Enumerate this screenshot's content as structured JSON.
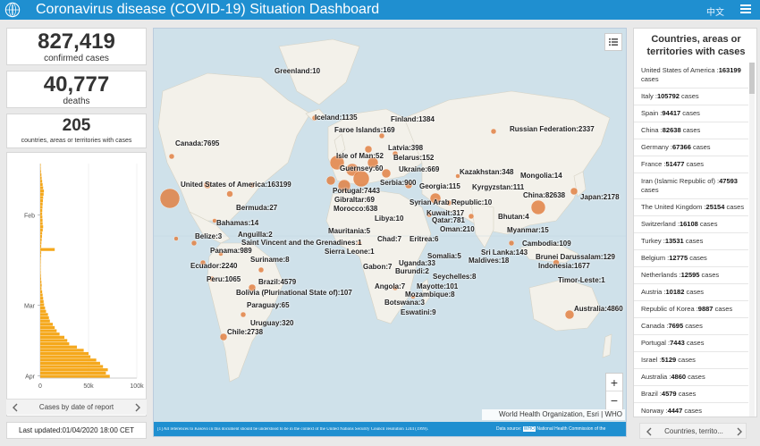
{
  "header": {
    "title": "Coronavirus disease (COVID-19) Situation Dashboard",
    "lang": "中文"
  },
  "stats": {
    "confirmed": {
      "value": "827,419",
      "label": "confirmed cases"
    },
    "deaths": {
      "value": "40,777",
      "label": "deaths"
    },
    "countries": {
      "value": "205",
      "label": "countries, areas or territories with cases"
    }
  },
  "epi_chart": {
    "footer_label": "Cases by date of report",
    "y_labels": [
      "Feb",
      "Mar",
      "Apr"
    ],
    "x_labels": [
      "0",
      "50k",
      "100k"
    ]
  },
  "chart_data": {
    "type": "bar",
    "orientation": "horizontal",
    "x_axis_ticks": [
      "0",
      "50k",
      "100k"
    ],
    "y_axis_ticks": [
      "Feb",
      "Mar",
      "Apr"
    ],
    "xlim": [
      0,
      100000
    ],
    "values": [
      200,
      500,
      800,
      1200,
      1500,
      2000,
      2500,
      3000,
      3800,
      3500,
      3000,
      2800,
      2500,
      2300,
      2100,
      2000,
      2200,
      2400,
      2500,
      3000,
      2600,
      2000,
      1800,
      1500,
      1200,
      1000,
      15000,
      1000,
      800,
      600,
      500,
      400,
      400,
      500,
      700,
      900,
      1200,
      1500,
      1300,
      2000,
      2500,
      3000,
      3500,
      4000,
      5000,
      6000,
      8000,
      9000,
      10000,
      13000,
      15000,
      17000,
      20000,
      25000,
      28000,
      30000,
      38000,
      45000,
      50000,
      52000,
      58000,
      62000,
      65000,
      70000,
      68000,
      72000
    ]
  },
  "updated": "Last updated:01/04/2020 18:00 CET",
  "map": {
    "attribution": "World Health Organization, Esri | WHO",
    "footnote": "[1] All references to Kosovo in this document should be understood to be in the context of the United Nations Security Council resolution 1244 (1999).",
    "source_prefix": "Data source:",
    "source_badge": "WHO",
    "source_text": "National Health Commission of the",
    "zoom_in": "+",
    "zoom_out": "−",
    "labels": [
      {
        "text": "Greenland:10",
        "x": 135,
        "y": 43
      },
      {
        "text": "Iceland:1135",
        "x": 180,
        "y": 95
      },
      {
        "text": "Finland:1384",
        "x": 265,
        "y": 97
      },
      {
        "text": "Faroe Islands:169",
        "x": 202,
        "y": 109
      },
      {
        "text": "Russian Federation:2337",
        "x": 398,
        "y": 108
      },
      {
        "text": "Canada:7695",
        "x": 24,
        "y": 124
      },
      {
        "text": "Latvia:398",
        "x": 262,
        "y": 129
      },
      {
        "text": "Belarus:152",
        "x": 268,
        "y": 140
      },
      {
        "text": "Isle of Man:52",
        "x": 204,
        "y": 138
      },
      {
        "text": "Guernsey:60",
        "x": 208,
        "y": 152
      },
      {
        "text": "Ukraine:669",
        "x": 274,
        "y": 153
      },
      {
        "text": "Kazakhstan:348",
        "x": 342,
        "y": 156
      },
      {
        "text": "Mongolia:14",
        "x": 410,
        "y": 160
      },
      {
        "text": "United States of America:163199",
        "x": 30,
        "y": 170
      },
      {
        "text": "Serbia:900",
        "x": 253,
        "y": 168
      },
      {
        "text": "Georgia:115",
        "x": 297,
        "y": 172
      },
      {
        "text": "Kyrgyzstan:111",
        "x": 356,
        "y": 173
      },
      {
        "text": "Portugal:7443",
        "x": 200,
        "y": 177
      },
      {
        "text": "China:82638",
        "x": 413,
        "y": 182
      },
      {
        "text": "Japan:2178",
        "x": 477,
        "y": 184
      },
      {
        "text": "Gibraltar:69",
        "x": 202,
        "y": 187
      },
      {
        "text": "Syrian Arab Republic:10",
        "x": 286,
        "y": 190
      },
      {
        "text": "Bermuda:27",
        "x": 92,
        "y": 196
      },
      {
        "text": "Morocco:638",
        "x": 201,
        "y": 197
      },
      {
        "text": "Kuwait:317",
        "x": 305,
        "y": 202
      },
      {
        "text": "Bhutan:4",
        "x": 385,
        "y": 206
      },
      {
        "text": "Libya:10",
        "x": 247,
        "y": 208
      },
      {
        "text": "Qatar:781",
        "x": 311,
        "y": 210
      },
      {
        "text": "Bahamas:14",
        "x": 70,
        "y": 213
      },
      {
        "text": "Oman:210",
        "x": 320,
        "y": 220
      },
      {
        "text": "Myanmar:15",
        "x": 395,
        "y": 221
      },
      {
        "text": "Belize:3",
        "x": 46,
        "y": 228
      },
      {
        "text": "Anguilla:2",
        "x": 94,
        "y": 226
      },
      {
        "text": "Mauritania:5",
        "x": 195,
        "y": 222
      },
      {
        "text": "Saint Vincent and the Grenadines:1",
        "x": 98,
        "y": 235
      },
      {
        "text": "Chad:7",
        "x": 250,
        "y": 231
      },
      {
        "text": "Eritrea:6",
        "x": 286,
        "y": 231
      },
      {
        "text": "Cambodia:109",
        "x": 412,
        "y": 236
      },
      {
        "text": "Panama:989",
        "x": 63,
        "y": 244
      },
      {
        "text": "Sierra Leone:1",
        "x": 191,
        "y": 245
      },
      {
        "text": "Sri Lanka:143",
        "x": 366,
        "y": 246
      },
      {
        "text": "Brunei Darussalam:129",
        "x": 427,
        "y": 251
      },
      {
        "text": "Suriname:8",
        "x": 108,
        "y": 254
      },
      {
        "text": "Somalia:5",
        "x": 306,
        "y": 250
      },
      {
        "text": "Maldives:18",
        "x": 352,
        "y": 255
      },
      {
        "text": "Uganda:33",
        "x": 274,
        "y": 258
      },
      {
        "text": "Ecuador:2240",
        "x": 41,
        "y": 261
      },
      {
        "text": "Gabon:7",
        "x": 234,
        "y": 262
      },
      {
        "text": "Indonesia:1677",
        "x": 430,
        "y": 261
      },
      {
        "text": "Burundi:2",
        "x": 270,
        "y": 267
      },
      {
        "text": "Peru:1065",
        "x": 59,
        "y": 276
      },
      {
        "text": "Brazil:4579",
        "x": 117,
        "y": 279
      },
      {
        "text": "Seychelles:8",
        "x": 312,
        "y": 273
      },
      {
        "text": "Timor-Leste:1",
        "x": 452,
        "y": 277
      },
      {
        "text": "Mayotte:101",
        "x": 294,
        "y": 284
      },
      {
        "text": "Angola:7",
        "x": 247,
        "y": 284
      },
      {
        "text": "Bolivia (Plurinational State of):107",
        "x": 92,
        "y": 291
      },
      {
        "text": "Mozambique:8",
        "x": 281,
        "y": 293
      },
      {
        "text": "Paraguay:65",
        "x": 104,
        "y": 305
      },
      {
        "text": "Botswana:3",
        "x": 258,
        "y": 302
      },
      {
        "text": "Australia:4860",
        "x": 470,
        "y": 309
      },
      {
        "text": "Eswatini:9",
        "x": 276,
        "y": 313
      },
      {
        "text": "Uruguay:320",
        "x": 108,
        "y": 325
      },
      {
        "text": "Chile:2738",
        "x": 82,
        "y": 335
      }
    ]
  },
  "country_list": {
    "header": "Countries, areas or territories with cases",
    "footer_label": "Countries, territo...",
    "items": [
      {
        "name": "United States of America",
        "cases": "163199",
        "suffix": "cases"
      },
      {
        "name": "Italy",
        "cases": "105792",
        "suffix": "cases"
      },
      {
        "name": "Spain",
        "cases": "94417",
        "suffix": "cases"
      },
      {
        "name": "China",
        "cases": "82638",
        "suffix": "cases"
      },
      {
        "name": "Germany",
        "cases": "67366",
        "suffix": "cases"
      },
      {
        "name": "France",
        "cases": "51477",
        "suffix": "cases"
      },
      {
        "name": "Iran (Islamic Republic of)",
        "cases": "47593",
        "suffix": "cases"
      },
      {
        "name": "The United Kingdom",
        "cases": "25154",
        "suffix": "cases"
      },
      {
        "name": "Switzerland",
        "cases": "16108",
        "suffix": "cases"
      },
      {
        "name": "Turkey",
        "cases": "13531",
        "suffix": "cases"
      },
      {
        "name": "Belgium",
        "cases": "12775",
        "suffix": "cases"
      },
      {
        "name": "Netherlands",
        "cases": "12595",
        "suffix": "cases"
      },
      {
        "name": "Austria",
        "cases": "10182",
        "suffix": "cases"
      },
      {
        "name": "Republic of Korea",
        "cases": "9887",
        "suffix": "cases"
      },
      {
        "name": "Canada",
        "cases": "7695",
        "suffix": "cases"
      },
      {
        "name": "Portugal",
        "cases": "7443",
        "suffix": "cases"
      },
      {
        "name": "Israel",
        "cases": "5129",
        "suffix": "cases"
      },
      {
        "name": "Australia",
        "cases": "4860",
        "suffix": "cases"
      },
      {
        "name": "Brazil",
        "cases": "4579",
        "suffix": "cases"
      },
      {
        "name": "Norway",
        "cases": "4447",
        "suffix": "cases"
      }
    ]
  },
  "colors": {
    "header_bg": "#1f8fd0",
    "bubble": "#e07b39",
    "bar": "#f5a81c",
    "ocean": "#cfe1ea",
    "land": "#f3f1ea"
  }
}
